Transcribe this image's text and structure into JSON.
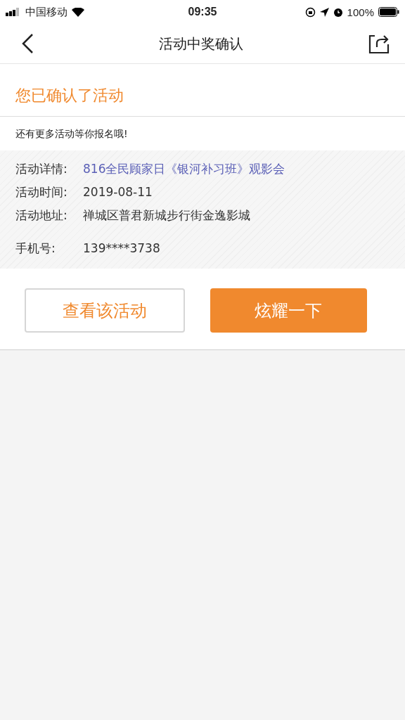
{
  "status_bar": {
    "carrier": "中国移动",
    "time": "09:35",
    "battery": "100%"
  },
  "nav": {
    "title": "活动中奖确认"
  },
  "heading": "您已确认了活动",
  "subtitle": "还有更多活动等你报名哦!",
  "details": [
    {
      "label": "活动详情:",
      "value": "816全民顾家日《银河补习班》观影会",
      "kind": "link"
    },
    {
      "label": "活动时间:",
      "value": "2019-08-11",
      "kind": "text"
    },
    {
      "label": "活动地址:",
      "value": "禅城区普君新城步行街金逸影城",
      "kind": "text"
    },
    {
      "label": "手机号:",
      "value": "139****3738",
      "kind": "spaced"
    }
  ],
  "buttons": [
    {
      "label": "查看该活动",
      "kind": "outline"
    },
    {
      "label": "炫耀一下",
      "kind": "primary"
    }
  ]
}
